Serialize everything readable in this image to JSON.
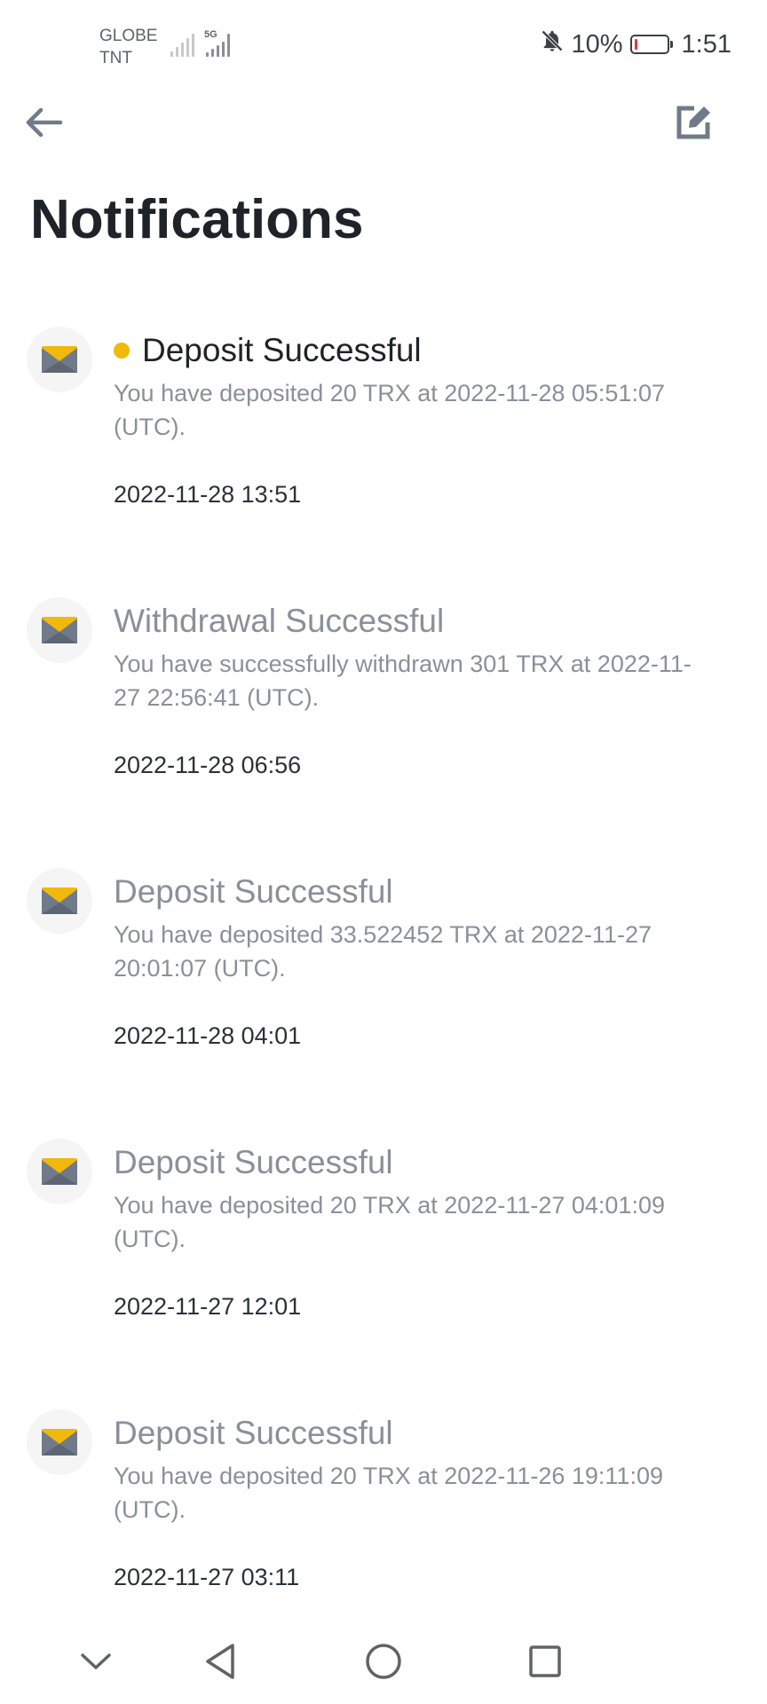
{
  "status_bar": {
    "carrier_line1": "GLOBE",
    "carrier_line2": "TNT",
    "network_type": "5G",
    "battery_text": "10%",
    "battery_level": 0.1,
    "time": "1:51"
  },
  "header": {
    "title": "Notifications",
    "back_icon": "arrow-left-icon",
    "edit_icon": "edit-icon"
  },
  "notifications": [
    {
      "title": "Deposit Successful",
      "body": "You have deposited 20 TRX at 2022-11-28 05:51:07 (UTC).",
      "time": "2022-11-28 13:51",
      "unread": true
    },
    {
      "title": "Withdrawal Successful",
      "body": "You have successfully withdrawn 301 TRX at 2022-11-27 22:56:41 (UTC).",
      "time": "2022-11-28 06:56",
      "unread": false
    },
    {
      "title": "Deposit Successful",
      "body": "You have deposited 33.522452 TRX at 2022-11-27 20:01:07 (UTC).",
      "time": "2022-11-28 04:01",
      "unread": false
    },
    {
      "title": "Deposit Successful",
      "body": "You have deposited 20 TRX at 2022-11-27 04:01:09 (UTC).",
      "time": "2022-11-27 12:01",
      "unread": false
    },
    {
      "title": "Deposit Successful",
      "body": "You have deposited 20 TRX at 2022-11-26 19:11:09 (UTC).",
      "time": "2022-11-27 03:11",
      "unread": false
    }
  ],
  "colors": {
    "accent": "#f0b90b",
    "title_unread": "#1e2329",
    "title_read": "#8a9099",
    "battery_low": "#e53935"
  },
  "nav_bar": {
    "icons": [
      "chevron-down-icon",
      "back-triangle-icon",
      "home-circle-icon",
      "recent-square-icon"
    ]
  }
}
